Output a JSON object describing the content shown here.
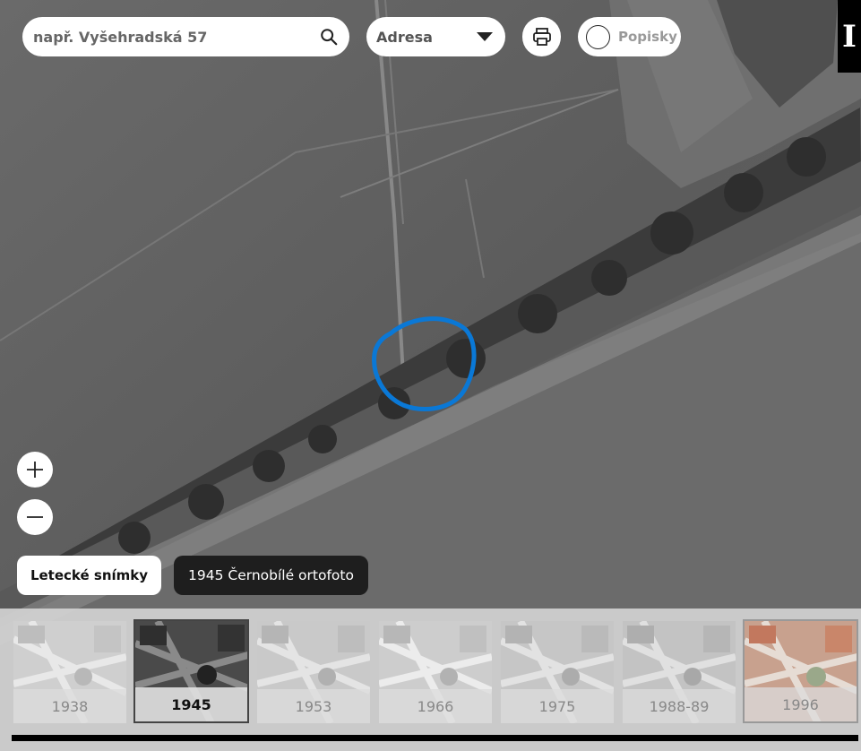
{
  "search": {
    "placeholder": "např. Vyšehradská 57"
  },
  "search_type": {
    "selected": "Adresa"
  },
  "labels_toggle": {
    "label": "Popisky"
  },
  "info_tab": {
    "label": "I"
  },
  "layer_buttons": {
    "aerial_label": "Letecké snímky",
    "current_layer": "1945 Černobílé ortofoto"
  },
  "icons": {
    "search": "search-icon",
    "dropdown": "caret-down-icon",
    "print": "printer-icon",
    "zoom_in": "plus-icon",
    "zoom_out": "minus-icon"
  },
  "timeline": {
    "years": [
      "1938",
      "1945",
      "1953",
      "1966",
      "1975",
      "1988-89",
      "1996"
    ],
    "active": "1945"
  },
  "colors": {
    "highlight_circle": "#0a78d6",
    "dark_pill": "#1e1e1e"
  }
}
